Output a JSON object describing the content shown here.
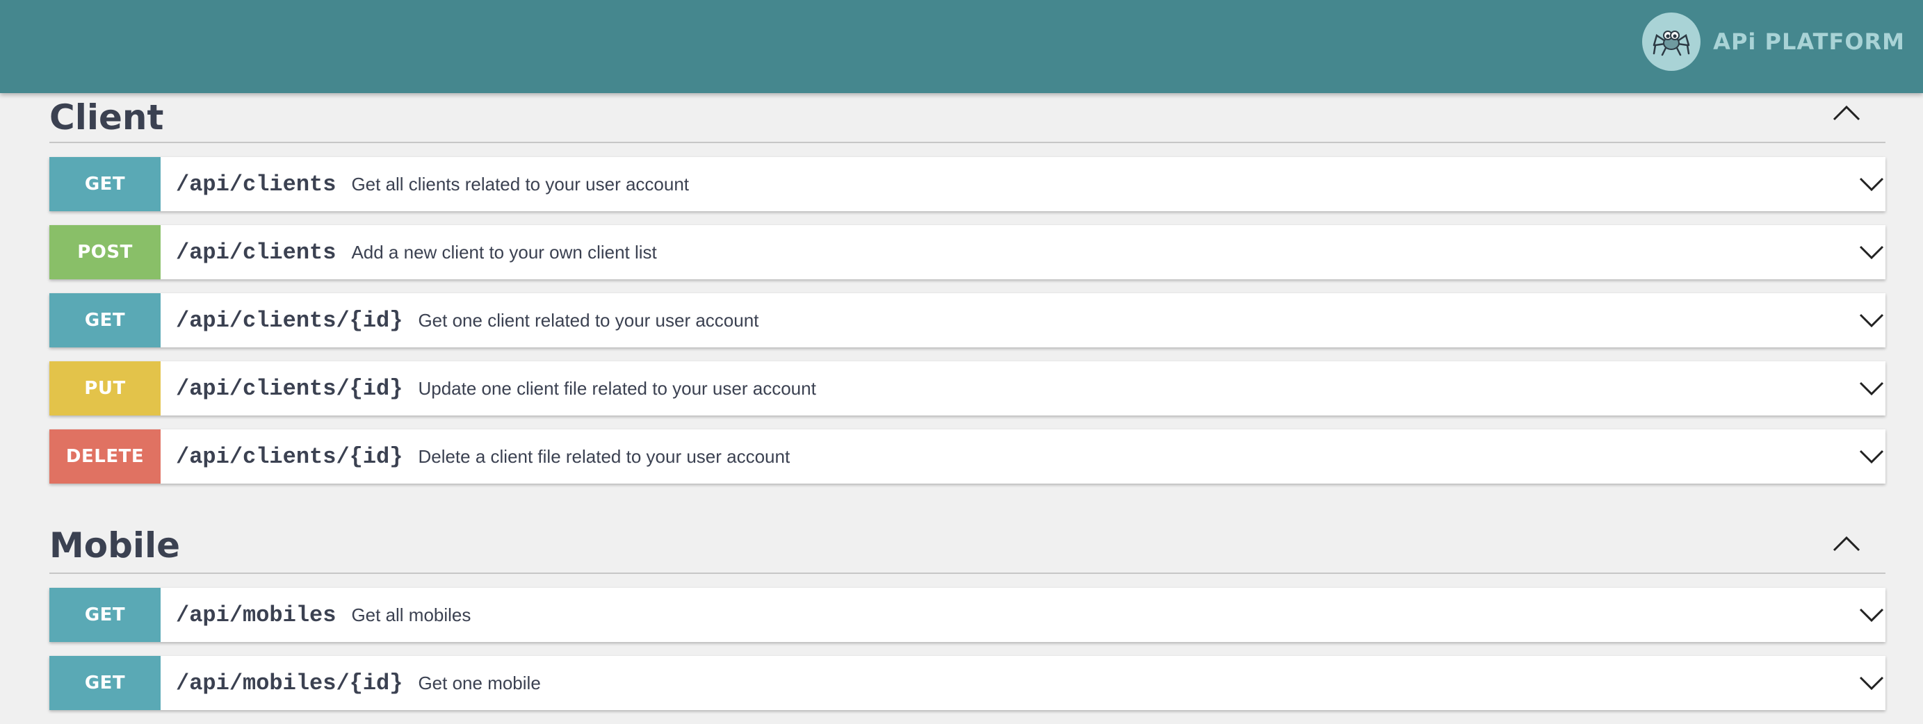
{
  "header": {
    "brand_text": "APi PLATFORM",
    "background": "#45878e",
    "logo_icon": "spider-icon"
  },
  "sections": [
    {
      "title": "Client",
      "expanded": true,
      "operations": [
        {
          "method": "GET",
          "path": "/api/clients",
          "summary": "Get all clients related to your user account"
        },
        {
          "method": "POST",
          "path": "/api/clients",
          "summary": "Add a new client to your own client list"
        },
        {
          "method": "GET",
          "path": "/api/clients/{id}",
          "summary": "Get one client related to your user account"
        },
        {
          "method": "PUT",
          "path": "/api/clients/{id}",
          "summary": "Update one client file related to your user account"
        },
        {
          "method": "DELETE",
          "path": "/api/clients/{id}",
          "summary": "Delete a client file related to your user account"
        }
      ]
    },
    {
      "title": "Mobile",
      "expanded": true,
      "operations": [
        {
          "method": "GET",
          "path": "/api/mobiles",
          "summary": "Get all mobiles"
        },
        {
          "method": "GET",
          "path": "/api/mobiles/{id}",
          "summary": "Get one mobile"
        }
      ]
    }
  ],
  "colors": {
    "get": "#5aa9b5",
    "post": "#89bf68",
    "put": "#e3c34a",
    "delete": "#e07262",
    "text": "#3b4151"
  }
}
